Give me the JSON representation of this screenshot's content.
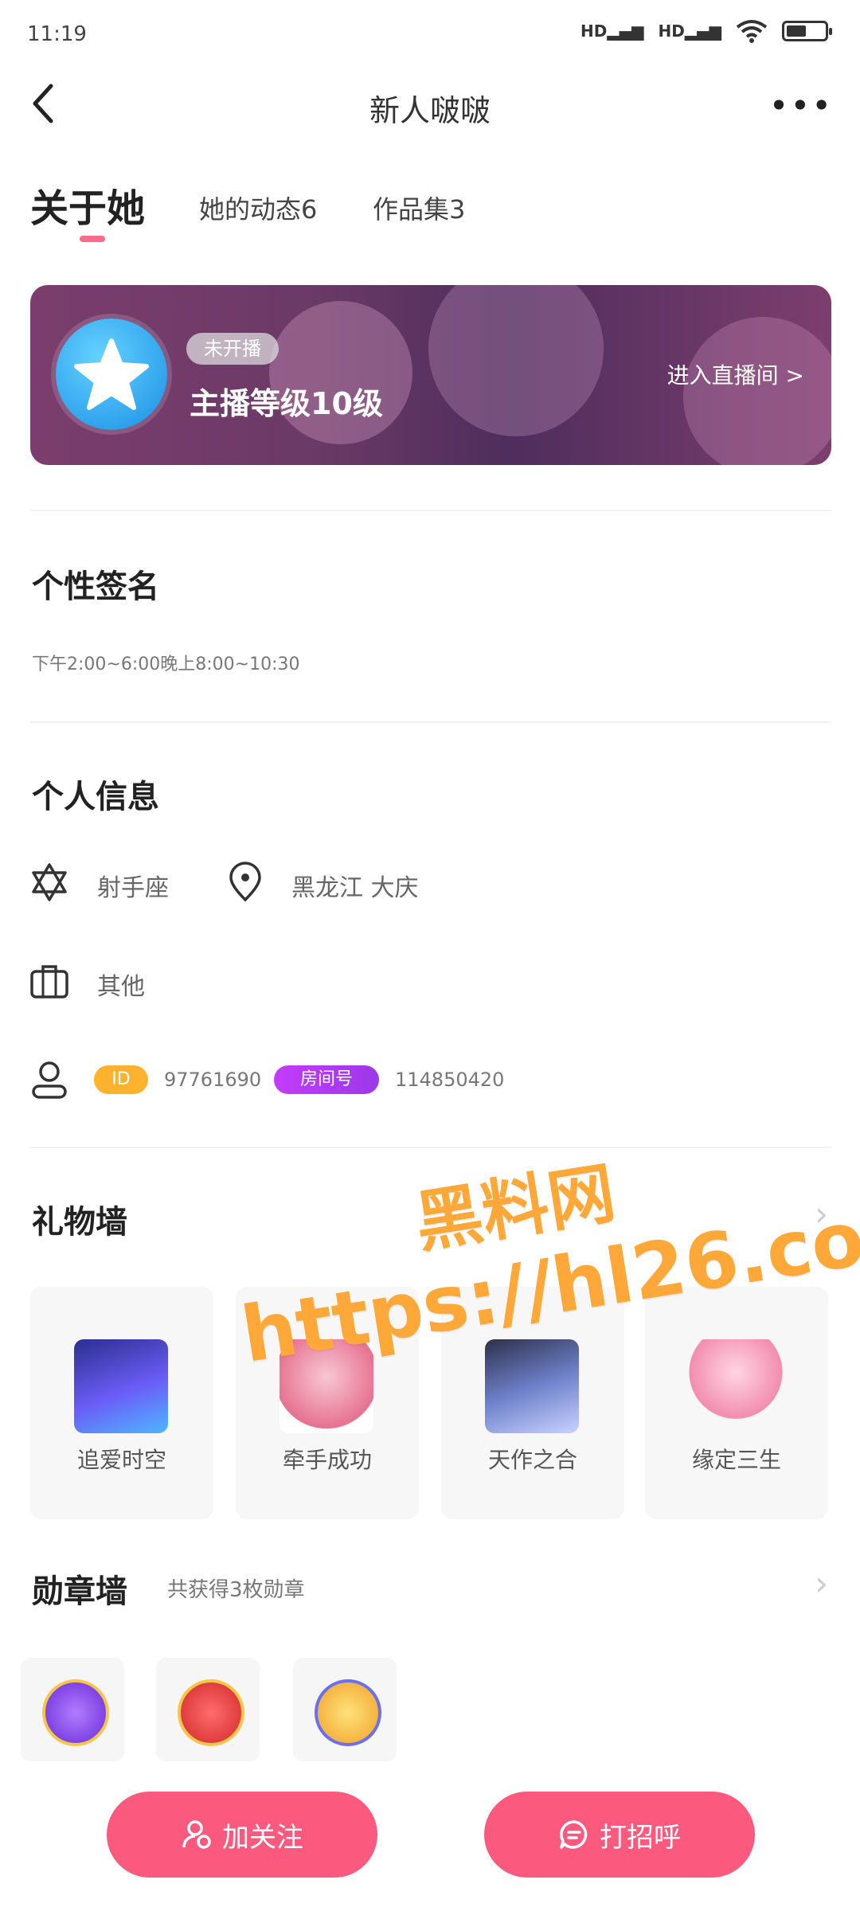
{
  "status_bar": {
    "time": "11:19",
    "signal1": "HD",
    "signal2": "HD"
  },
  "nav": {
    "title": "新人啵啵"
  },
  "tabs": [
    {
      "label": "关于她"
    },
    {
      "label": "她的动态6"
    },
    {
      "label": "作品集3"
    }
  ],
  "anchor_card": {
    "live_status": "未开播",
    "level_text": "主播等级10级",
    "enter_live": "进入直播间 >"
  },
  "signature": {
    "title": "个性签名",
    "text": "下午2:00~6:00晚上8:00~10:30"
  },
  "personal_info": {
    "title": "个人信息",
    "zodiac": "射手座",
    "location": "黑龙江 大庆",
    "occupation": "其他",
    "id_label": "ID",
    "id_value": "97761690",
    "room_label": "房间号",
    "room_value": "114850420"
  },
  "gift_wall": {
    "title": "礼物墙",
    "items": [
      {
        "name": "追爱时空"
      },
      {
        "name": "牵手成功"
      },
      {
        "name": "天作之合"
      },
      {
        "name": "缘定三生"
      }
    ]
  },
  "medal_wall": {
    "title": "勋章墙",
    "count_text": "共获得3枚勋章",
    "medals": [
      "medal-1",
      "medal-2",
      "medal-3"
    ]
  },
  "actions": {
    "follow": "加关注",
    "greet": "打招呼"
  },
  "watermark": {
    "line1": "黑料网",
    "line2": "https://hl26.co"
  },
  "colors": {
    "accent": "#fb5a7e",
    "tab_indicator": "#ff6a8a",
    "id_badge": "#ffb22e",
    "room_badge": "#b13bf5",
    "watermark": "#ffa83a"
  }
}
